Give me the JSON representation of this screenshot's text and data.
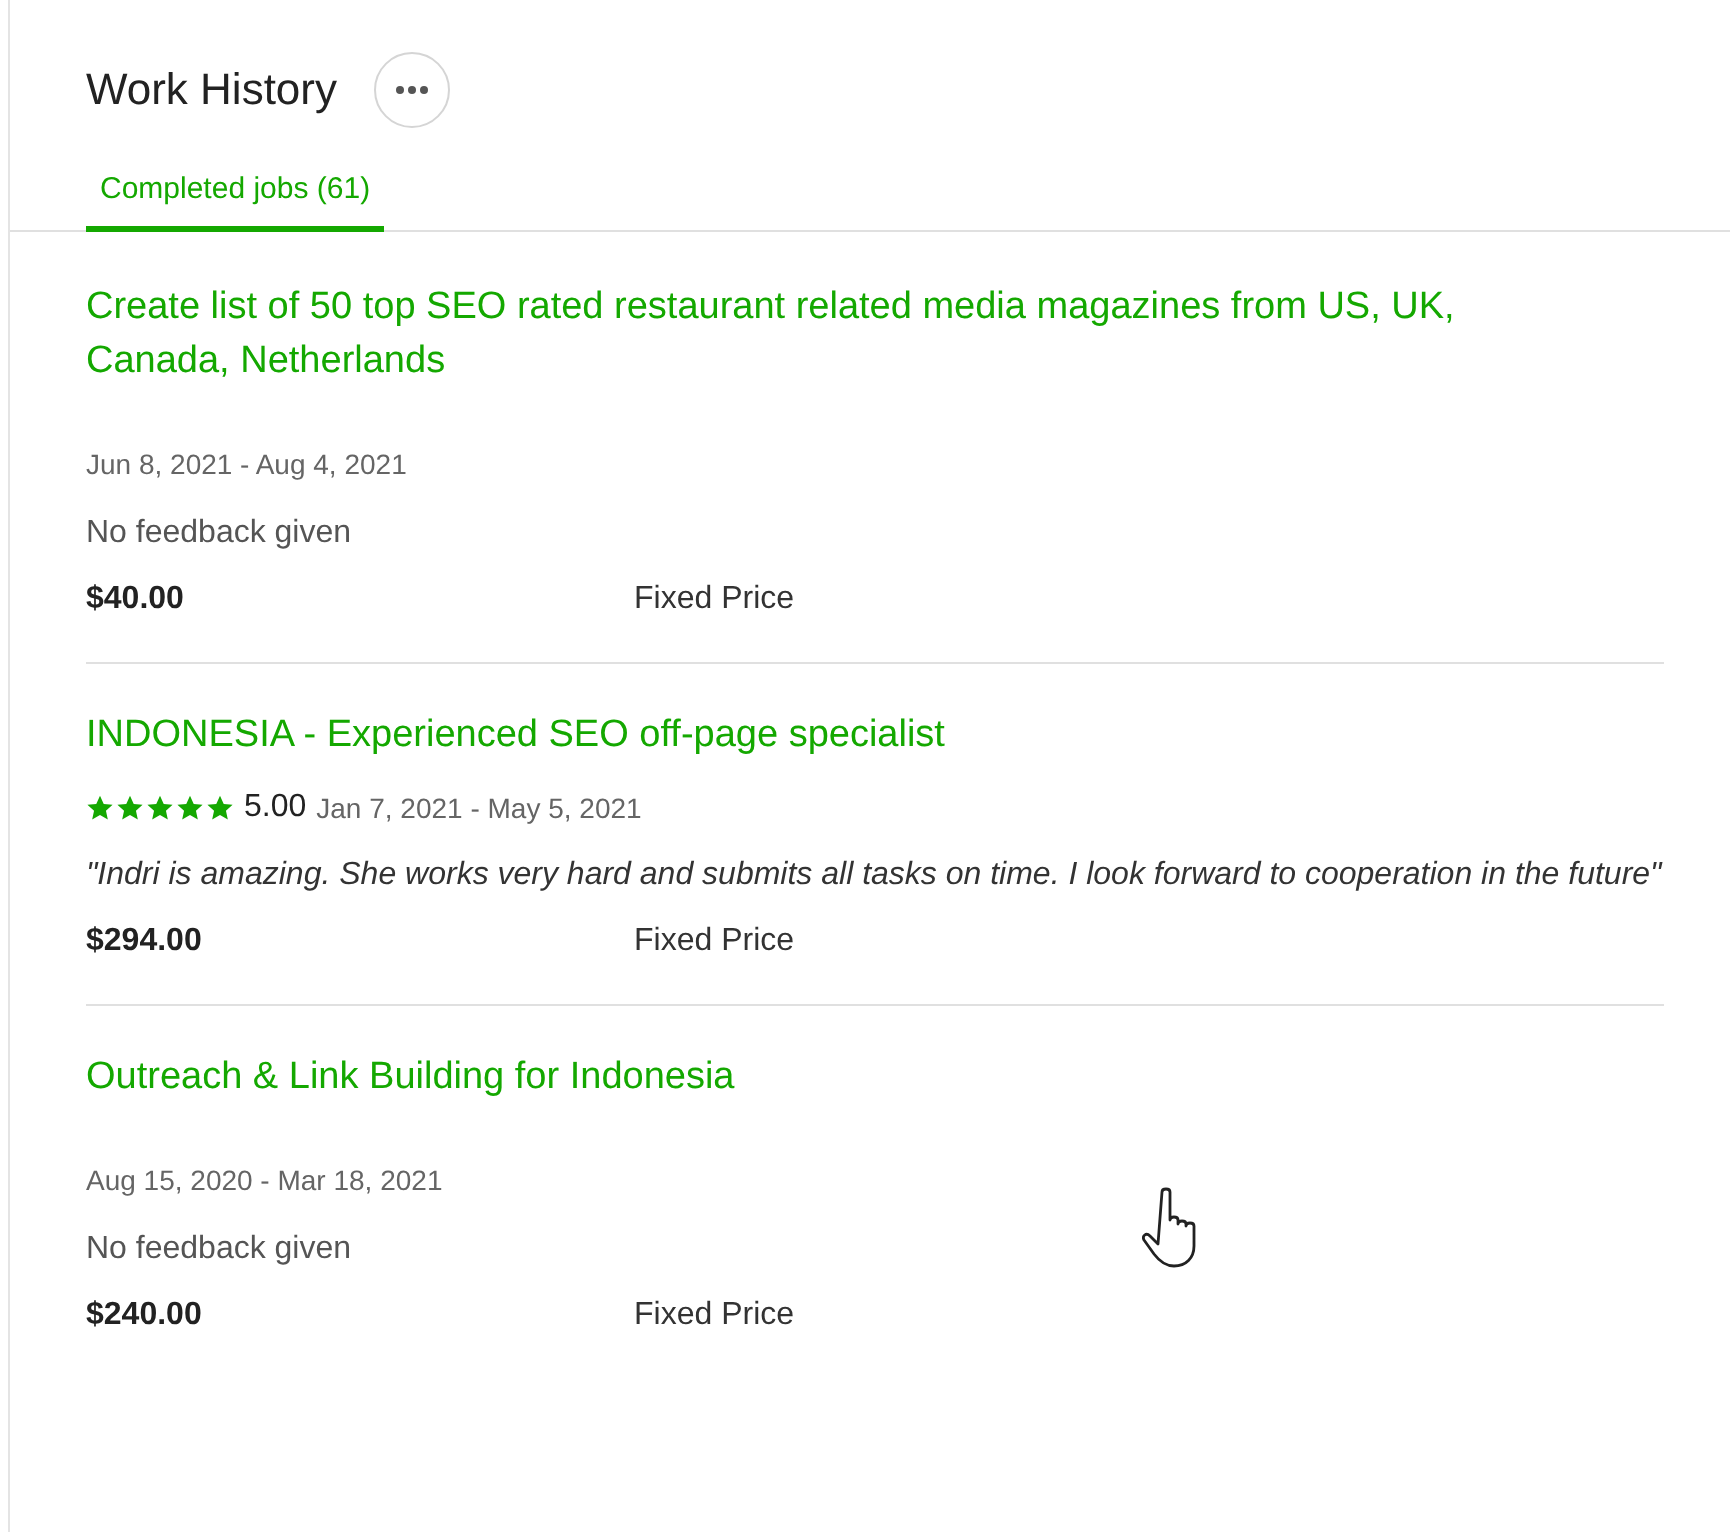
{
  "section": {
    "title": "Work History"
  },
  "tabs": [
    {
      "label": "Completed jobs (61)",
      "selected": true
    }
  ],
  "jobs": [
    {
      "kind": "no_feedback",
      "title": "Create list of 50 top SEO rated restaurant related media magazines from US, UK, Canada, Netherlands",
      "dates": "Jun 8, 2021 - Aug 4, 2021",
      "feedback": "No feedback given",
      "amount": "$40.00",
      "price_type": "Fixed Price"
    },
    {
      "kind": "review",
      "title": "INDONESIA - Experienced SEO off-page specialist",
      "stars": 5,
      "score": "5.00",
      "dates": "Jan 7, 2021 - May 5, 2021",
      "feedback": "\"Indri is amazing. She works very hard and submits all tasks on time. I look forward to cooperation in the future\"",
      "amount": "$294.00",
      "price_type": "Fixed Price"
    },
    {
      "kind": "no_feedback",
      "title": "Outreach & Link Building for Indonesia",
      "dates": "Aug 15, 2020 - Mar 18, 2021",
      "feedback": "No feedback given",
      "amount": "$240.00",
      "price_type": "Fixed Price"
    }
  ]
}
